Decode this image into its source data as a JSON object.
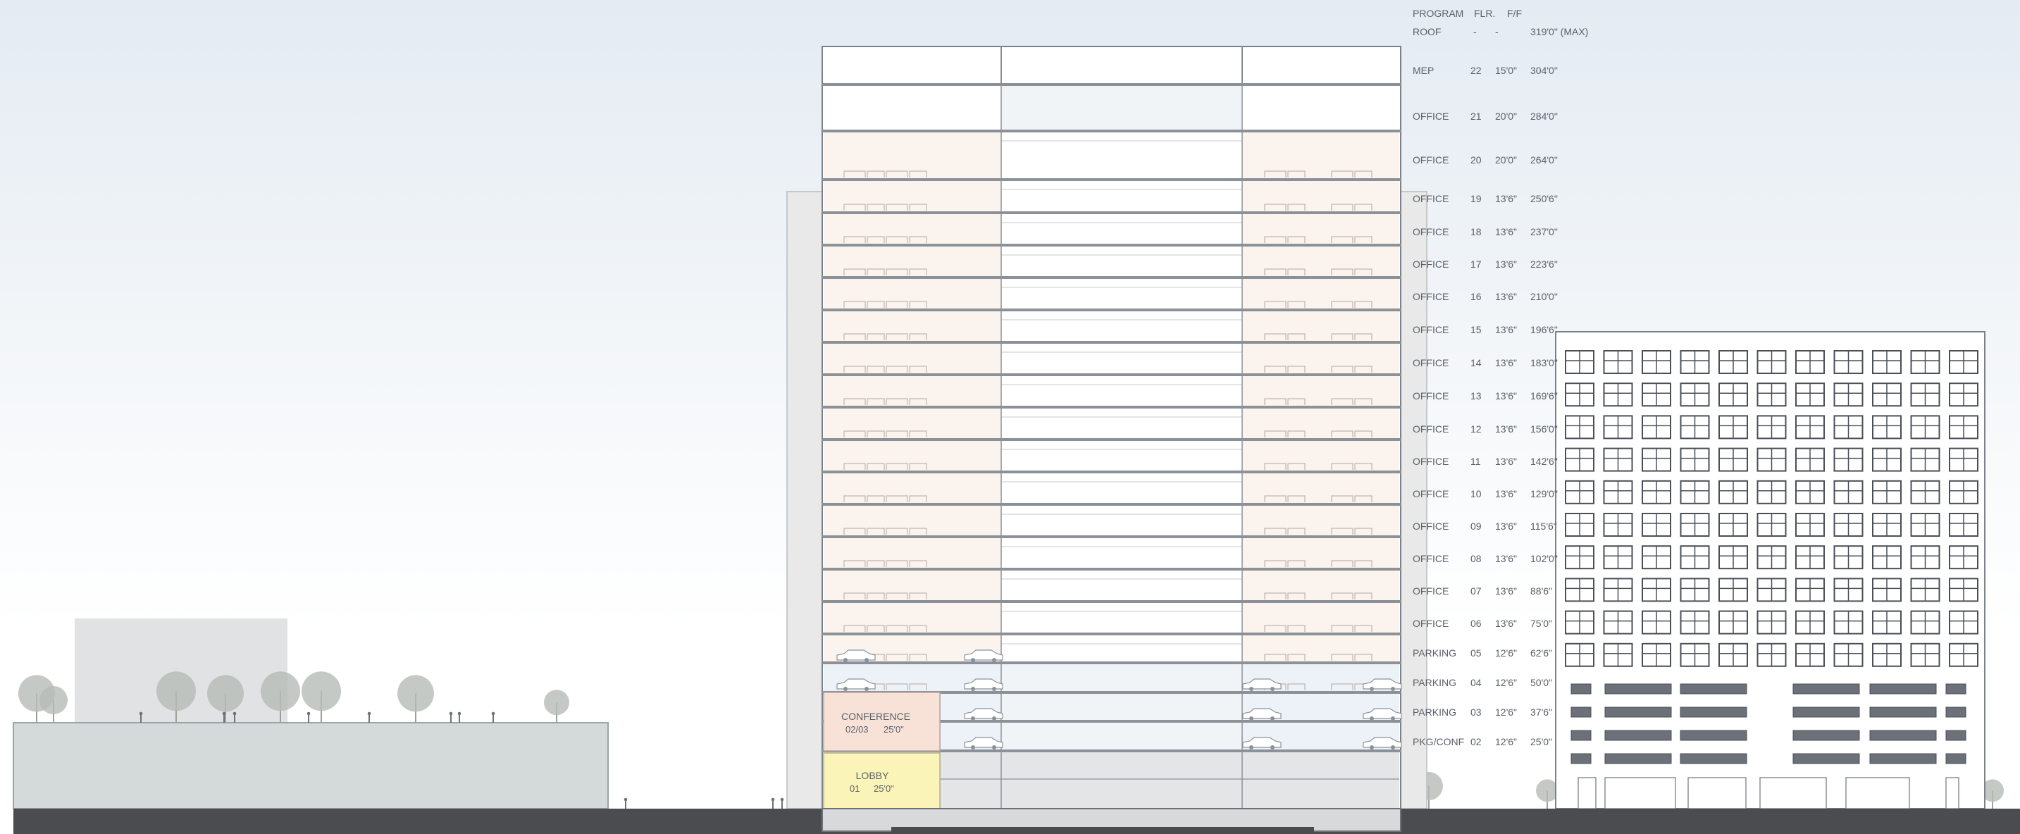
{
  "headers": {
    "program": "PROGRAM",
    "floor": "FLR.",
    "f2f": "F/F"
  },
  "floors": [
    {
      "program": "ROOF",
      "floor": "-",
      "f2f": "-",
      "elev": "319'0\" (MAX)"
    },
    {
      "program": "MEP",
      "floor": "22",
      "f2f": "15'0\"",
      "elev": "304'0\""
    },
    {
      "program": "OFFICE",
      "floor": "21",
      "f2f": "20'0\"",
      "elev": "284'0\""
    },
    {
      "program": "OFFICE",
      "floor": "20",
      "f2f": "20'0\"",
      "elev": "264'0\""
    },
    {
      "program": "OFFICE",
      "floor": "19",
      "f2f": "13'6\"",
      "elev": "250'6\""
    },
    {
      "program": "OFFICE",
      "floor": "18",
      "f2f": "13'6\"",
      "elev": "237'0\""
    },
    {
      "program": "OFFICE",
      "floor": "17",
      "f2f": "13'6\"",
      "elev": "223'6\""
    },
    {
      "program": "OFFICE",
      "floor": "16",
      "f2f": "13'6\"",
      "elev": "210'0\""
    },
    {
      "program": "OFFICE",
      "floor": "15",
      "f2f": "13'6\"",
      "elev": "196'6\""
    },
    {
      "program": "OFFICE",
      "floor": "14",
      "f2f": "13'6\"",
      "elev": "183'0\""
    },
    {
      "program": "OFFICE",
      "floor": "13",
      "f2f": "13'6\"",
      "elev": "169'6\""
    },
    {
      "program": "OFFICE",
      "floor": "12",
      "f2f": "13'6\"",
      "elev": "156'0\""
    },
    {
      "program": "OFFICE",
      "floor": "11",
      "f2f": "13'6\"",
      "elev": "142'6\""
    },
    {
      "program": "OFFICE",
      "floor": "10",
      "f2f": "13'6\"",
      "elev": "129'0\""
    },
    {
      "program": "OFFICE",
      "floor": "09",
      "f2f": "13'6\"",
      "elev": "115'6\""
    },
    {
      "program": "OFFICE",
      "floor": "08",
      "f2f": "13'6\"",
      "elev": "102'0\""
    },
    {
      "program": "OFFICE",
      "floor": "07",
      "f2f": "13'6\"",
      "elev": "88'6\""
    },
    {
      "program": "OFFICE",
      "floor": "06",
      "f2f": "13'6\"",
      "elev": "75'0\""
    },
    {
      "program": "PARKING",
      "floor": "05",
      "f2f": "12'6\"",
      "elev": "62'6\""
    },
    {
      "program": "PARKING",
      "floor": "04",
      "f2f": "12'6\"",
      "elev": "50'0\""
    },
    {
      "program": "PARKING",
      "floor": "03",
      "f2f": "12'6\"",
      "elev": "37'6\""
    },
    {
      "program": "PKG/CONF",
      "floor": "02",
      "f2f": "12'6\"",
      "elev": "25'0\""
    }
  ],
  "conference": {
    "title": "CONFERENCE",
    "floors": "02/03",
    "height": "25'0\""
  },
  "lobby": {
    "title": "LOBBY",
    "floor": "01",
    "height": "25'0\""
  },
  "colors": {
    "sky_top": "#e4ebf2",
    "office_fill": "#fbf3ee",
    "parking_fill": "#edf2f8",
    "conference_fill": "#f8e2d8",
    "lobby_fill": "#fbf4b8",
    "core_fill": "#ffffff",
    "ground": "#4a4c50",
    "podium": "#d4d9d9",
    "slab": "#8c9198",
    "tree": "#b6bcb6",
    "text": "#5a6068"
  }
}
